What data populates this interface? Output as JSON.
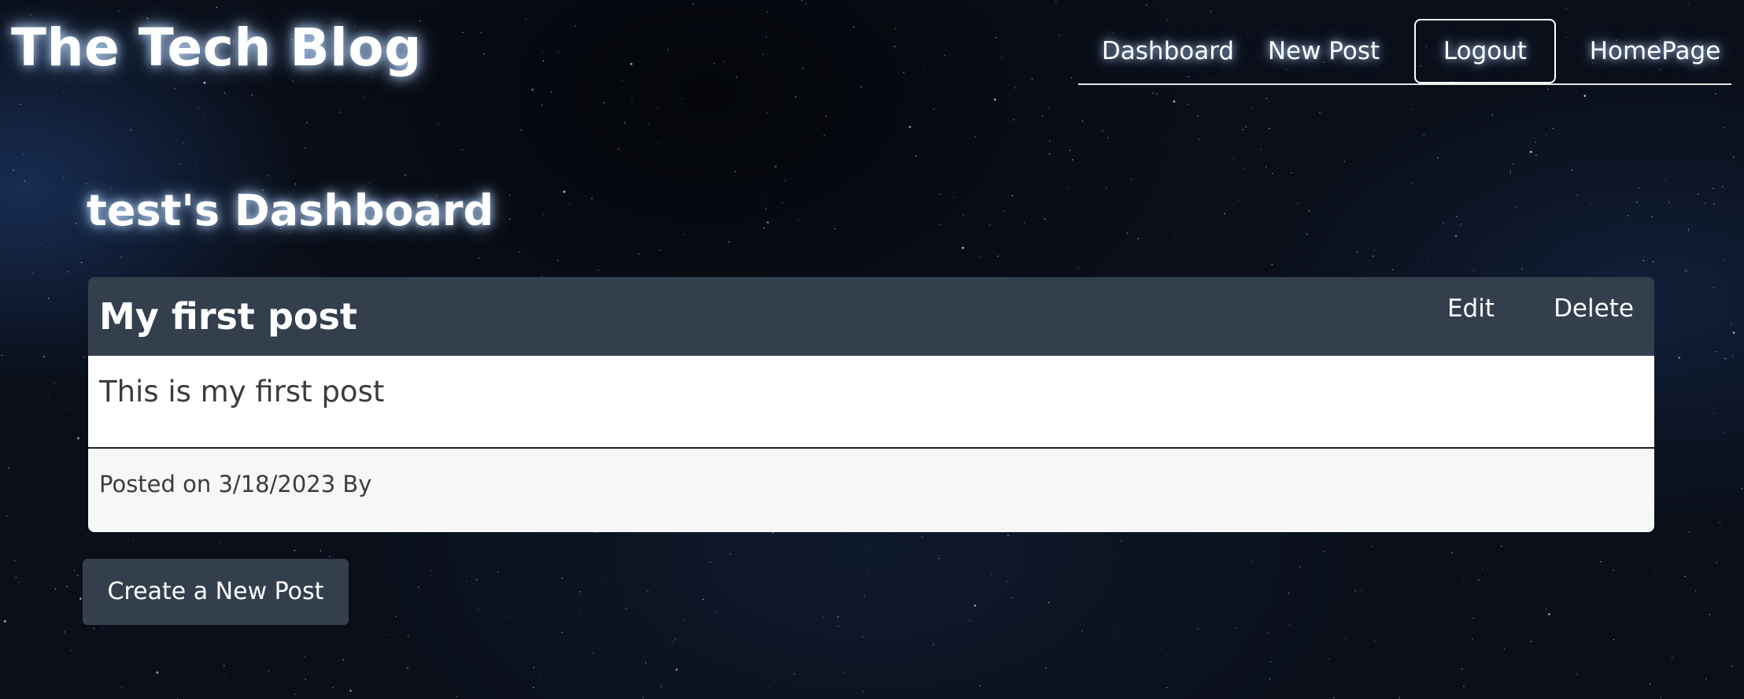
{
  "header": {
    "brand": "The Tech Blog",
    "nav": {
      "dashboard": "Dashboard",
      "new_post": "New Post",
      "logout": "Logout",
      "homepage": "HomePage"
    }
  },
  "main": {
    "title": "test's Dashboard",
    "posts": [
      {
        "title": "My first post",
        "edit_label": "Edit",
        "delete_label": "Delete",
        "content": "This is my first post",
        "meta": "Posted on 3/18/2023 By"
      }
    ],
    "create_label": "Create a New Post"
  },
  "colors": {
    "background": "#0a0f1a",
    "card_header": "#343f4e",
    "card_body": "#ffffff",
    "card_footer": "#f7f7f7",
    "button": "#343f4e",
    "text_light": "#ffffff",
    "text_dark": "#3c3c3c"
  }
}
